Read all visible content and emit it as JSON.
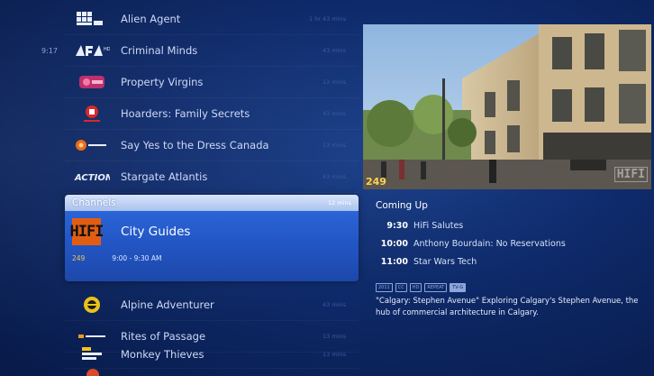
{
  "guide": {
    "rows": [
      {
        "time": "",
        "title": "Alien Agent",
        "duration": "1 hr 43 mins"
      },
      {
        "time": "9:17",
        "title": "Criminal Minds",
        "duration": "43 mins"
      },
      {
        "time": "",
        "title": "Property Virgins",
        "duration": "13 mins"
      },
      {
        "time": "",
        "title": "Hoarders: Family Secrets",
        "duration": "43 mins"
      },
      {
        "time": "",
        "title": "Say Yes to the Dress Canada",
        "duration": "13 mins"
      },
      {
        "time": "",
        "title": "Stargate Atlantis",
        "duration": "43 mins"
      },
      {
        "time": "",
        "title": "Alpine Adventurer",
        "duration": "43 mins"
      },
      {
        "time": "",
        "title": "Rites of Passage",
        "duration": "13 mins"
      },
      {
        "time": "",
        "title": "Monkey Thieves",
        "duration": "13 mins"
      }
    ],
    "selected": {
      "header": "Channels",
      "duration": "12 mins",
      "logo": "HIFI",
      "title": "City Guides",
      "channel": "249",
      "time": "9:00 - 9:30 AM"
    }
  },
  "preview": {
    "channel": "249",
    "watermark": "HIFI"
  },
  "coming_up": {
    "header": "Coming Up",
    "items": [
      {
        "time": "9:30",
        "title": "HiFi Salutes"
      },
      {
        "time": "10:00",
        "title": "Anthony Bourdain: No Reservations"
      },
      {
        "time": "11:00",
        "title": "Star Wars Tech"
      }
    ],
    "badges": [
      "2011",
      "CC",
      "HD",
      "REPEAT",
      "TV-G"
    ],
    "description": "\"Calgary: Stephen Avenue\" Exploring Calgary's Stephen Avenue, the hub of commercial architecture in Calgary."
  }
}
